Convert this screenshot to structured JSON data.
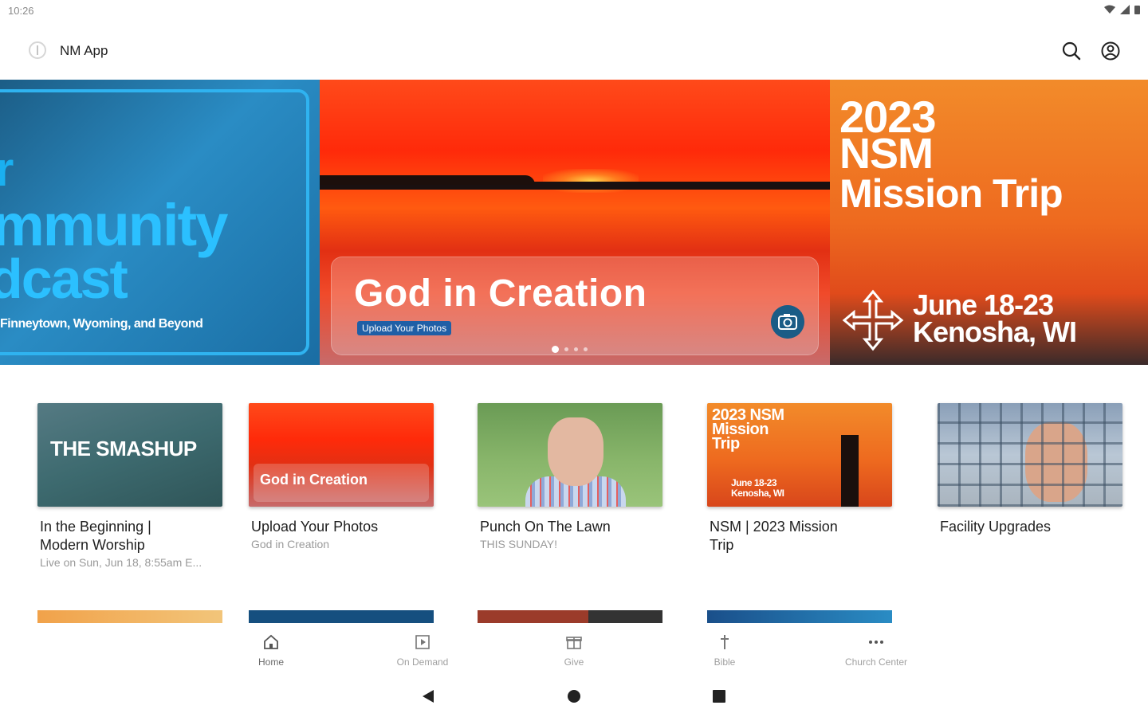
{
  "status_bar": {
    "time": "10:26"
  },
  "app_bar": {
    "title": "NM App"
  },
  "carousel": {
    "podcast": {
      "line1": "r",
      "line2": "mmunity",
      "line3": "dcast",
      "subtitle": "Finneytown, Wyoming, and Beyond"
    },
    "creation": {
      "title": "God in Creation",
      "tag": "Upload Your Photos"
    },
    "mission": {
      "year": "2023",
      "org": "NSM",
      "title": "Mission Trip",
      "dates": "June 18-23",
      "location": "Kenosha, WI"
    },
    "page_count": 4,
    "active_page": 1
  },
  "cards": [
    {
      "thumb_text": "THE SMASHUP",
      "title_line1": "In the Beginning |",
      "title_line2": "Modern Worship",
      "subtitle": "Live on Sun, Jun 18, 8:55am E..."
    },
    {
      "thumb_text": "God in Creation",
      "title_line1": "Upload Your Photos",
      "title_line2": "",
      "subtitle": "God in Creation"
    },
    {
      "thumb_text": "",
      "title_line1": "Punch On The Lawn",
      "title_line2": "",
      "subtitle": "THIS SUNDAY!"
    },
    {
      "thumb_text": "2023 NSM Mission Trip",
      "thumb_text_small": "June 18-23 Kenosha, WI",
      "title_line1": "NSM | 2023 Mission",
      "title_line2": "Trip",
      "subtitle": ""
    },
    {
      "thumb_text": "",
      "title_line1": "Facility Upgrades",
      "title_line2": "",
      "subtitle": ""
    }
  ],
  "bottom_nav": [
    {
      "label": "Home",
      "icon": "home-icon",
      "active": true
    },
    {
      "label": "On Demand",
      "icon": "play-icon",
      "active": false
    },
    {
      "label": "Give",
      "icon": "gift-icon",
      "active": false
    },
    {
      "label": "Bible",
      "icon": "cross-icon",
      "active": false
    },
    {
      "label": "Church Center",
      "icon": "more-icon",
      "active": false
    }
  ],
  "colors": {
    "accent_blue": "#1f5fa6",
    "podcast_cyan": "#2bc0ff",
    "sunset_orange": "#ee6a1f"
  }
}
